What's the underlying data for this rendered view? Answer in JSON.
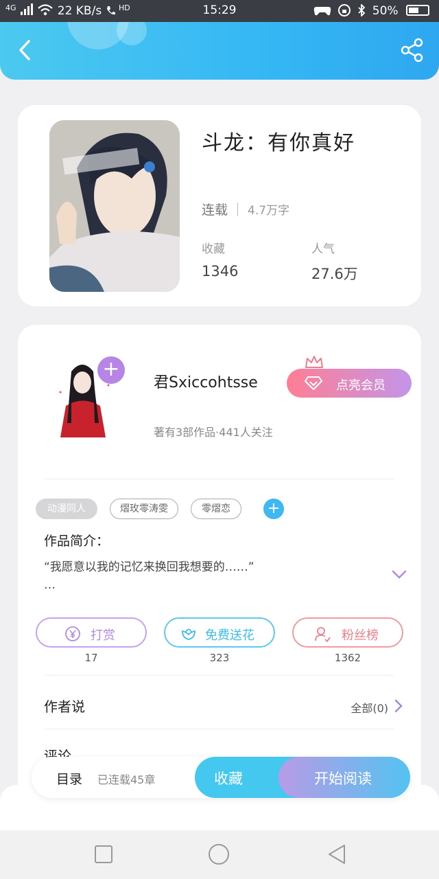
{
  "status_bar": {
    "network": "4G",
    "speed": "22 KB/s",
    "hd": "HD",
    "time": "15:29",
    "battery": "50%"
  },
  "header": {
    "back_icon": "chevron-left-icon",
    "share_icon": "share-icon"
  },
  "book": {
    "title": "斗龙：有你真好",
    "status": "连载",
    "word_count": "4.7万字",
    "collect_label": "收藏",
    "collect_value": "1346",
    "popularity_label": "人气",
    "popularity_value": "27.6万"
  },
  "author": {
    "name": "君Sxiccohtsse",
    "follow_icon": "+",
    "summary": "著有3部作品·441人关注",
    "vip_button": "点亮会员"
  },
  "tags": [
    "动漫同人",
    "熠玫零涛雯",
    "零熠恋"
  ],
  "tag_add": "+",
  "intro": {
    "label": "作品简介：",
    "text": "“我愿意以我的记忆来换回我想要的……”",
    "more": "…"
  },
  "actions": [
    {
      "label": "打赏",
      "count": "17",
      "icon": "yen-coin-icon"
    },
    {
      "label": "免费送花",
      "count": "323",
      "icon": "flower-icon"
    },
    {
      "label": "粉丝榜",
      "count": "1362",
      "icon": "user-rank-icon"
    }
  ],
  "author_says": {
    "label": "作者说",
    "right": "全部(0)"
  },
  "comments": {
    "label": "评论"
  },
  "bottom_bar": {
    "toc": "目录",
    "serial": "已连载45章",
    "collect": "收藏",
    "read": "开始阅读"
  },
  "colors": {
    "header_blue": "#35b7f4",
    "purple": "#b685e6",
    "pink": "#ff7e94"
  }
}
